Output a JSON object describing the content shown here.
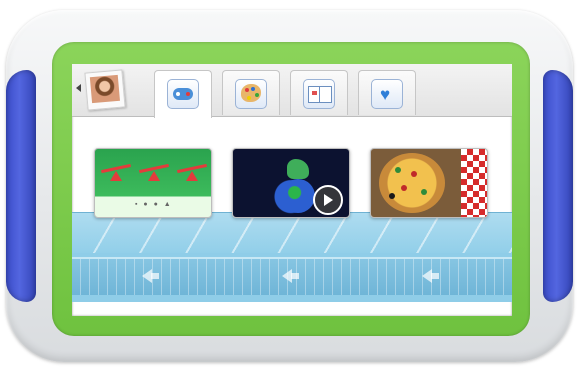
{
  "colors": {
    "grip": "#4456d4",
    "bezel": "#7dcc4b",
    "carousel": "#8fcde8",
    "accent": "#2f7fd8"
  },
  "tabbar": {
    "back": {
      "icon": "chevron-left-icon"
    },
    "profile": {
      "icon": "child-photo-icon"
    },
    "tabs": [
      {
        "key": "games",
        "icon": "gamepad-icon",
        "active": true
      },
      {
        "key": "art",
        "icon": "paint-palette-icon",
        "active": false
      },
      {
        "key": "books",
        "icon": "book-icon",
        "active": false
      },
      {
        "key": "favorites",
        "icon": "heart-icon",
        "active": false
      }
    ]
  },
  "carousel": {
    "cards": [
      {
        "key": "seesaw-game",
        "icon": "seesaw-icon"
      },
      {
        "key": "dinosaur-video",
        "icon": "dinosaur-earth-icon",
        "has_play": true
      },
      {
        "key": "pizza-game",
        "icon": "pizza-icon"
      }
    ]
  },
  "symbols": {
    "heart": "♥"
  }
}
